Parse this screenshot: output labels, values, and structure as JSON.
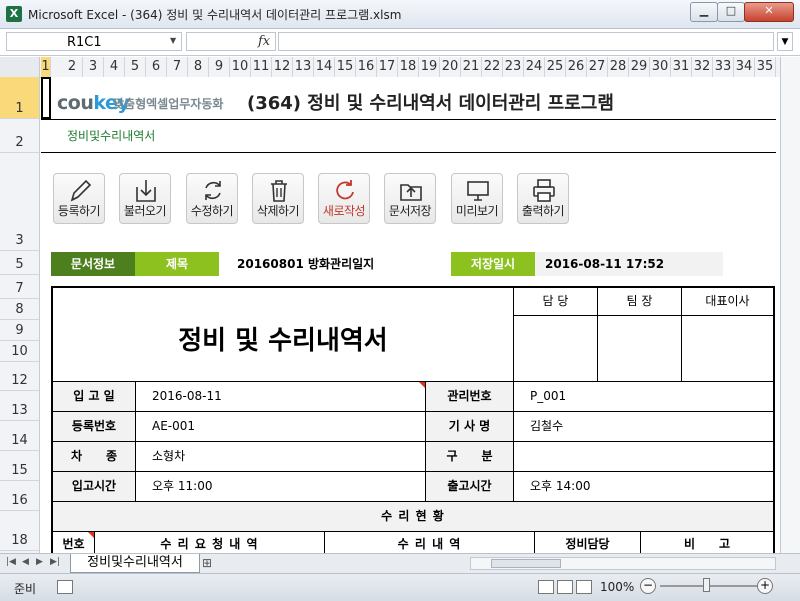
{
  "window": {
    "title": "Microsoft Excel - (364) 정비 및 수리내역서 데이터관리 프로그램.xlsm",
    "app_icon": "X",
    "minimize": "▁",
    "maximize": "□",
    "close": "✕"
  },
  "formula_bar": {
    "name_box": "R1C1",
    "fx": "fx",
    "value": ""
  },
  "columns": [
    "1",
    "2",
    "3",
    "4",
    "5",
    "6",
    "7",
    "8",
    "9",
    "10",
    "11",
    "12",
    "13",
    "14",
    "15",
    "16",
    "17",
    "18",
    "19",
    "20",
    "21",
    "22",
    "23",
    "24",
    "25",
    "26",
    "27",
    "28",
    "29",
    "30",
    "31",
    "32",
    "33",
    "34",
    "35"
  ],
  "rows": [
    "1",
    "2",
    "3",
    "5",
    "7",
    "8",
    "9",
    "10",
    "12",
    "13",
    "14",
    "15",
    "16",
    "18"
  ],
  "sheet": {
    "logo_a": "cou",
    "logo_b": "key",
    "logo_tagline": "맞춤형엑셀업무자동화",
    "title": "(364) 정비 및 수리내역서 데이터관리 프로그램",
    "subtitle": "정비및수리내역서"
  },
  "toolbar": {
    "register": "등록하기",
    "load": "불러오기",
    "edit": "수정하기",
    "delete": "삭제하기",
    "new": "새로작성",
    "save_doc": "문서저장",
    "preview": "미리보기",
    "print": "출력하기"
  },
  "info": {
    "doc_info_label": "문서정보",
    "subject_label": "제목",
    "subject_value": "20160801 방화관리일지",
    "saved_label": "저장일시",
    "saved_value": "2016-08-11 17:52"
  },
  "form": {
    "title": "정비 및 수리내역서",
    "approvals": [
      "담 당",
      "팀 장",
      "대표이사"
    ],
    "in_date_label": "입 고 일",
    "in_date_value": "2016-08-11",
    "mgmt_no_label": "관리번호",
    "mgmt_no_value": "P_001",
    "reg_no_label": "등록번호",
    "reg_no_value": "AE-001",
    "driver_label": "기 사 명",
    "driver_value": "김철수",
    "vehicle_label": "차　　종",
    "vehicle_value": "소형차",
    "category_label": "구　　분",
    "category_value": "",
    "in_time_label": "입고시간",
    "in_time_value": "오후 11:00",
    "out_time_label": "출고시간",
    "out_time_value": "오후 14:00",
    "repair_status": "수 리 현 황",
    "col_no": "번호",
    "col_request": "수 리 요 청 내 역",
    "col_repair": "수 리 내 역",
    "col_manager": "정비담당",
    "col_note": "비　　고"
  },
  "tabs": {
    "active": "정비및수리내역서"
  },
  "status": {
    "ready": "준비",
    "zoom": "100%",
    "zoom_minus": "−",
    "zoom_plus": "+"
  }
}
